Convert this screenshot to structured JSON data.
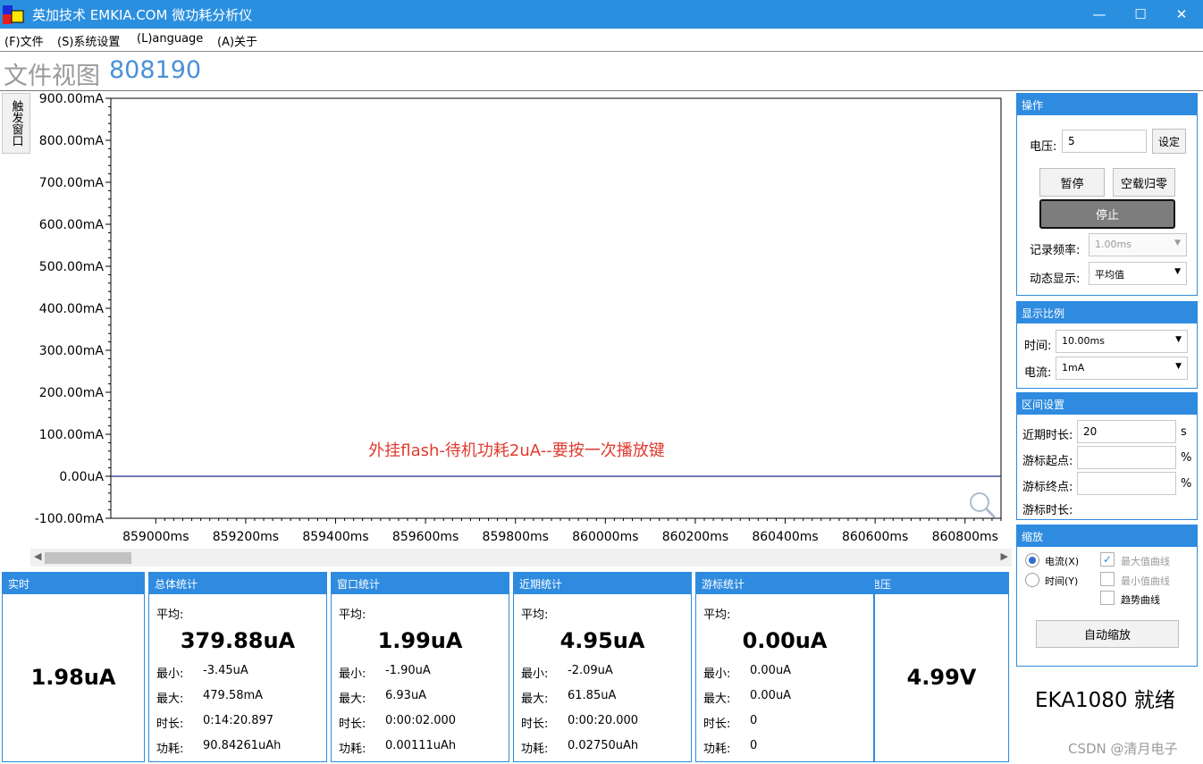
{
  "window": {
    "title": "英加技术 EMKIA.COM 微功耗分析仪",
    "minimize_glyph": "—",
    "maximize_glyph": "☐",
    "close_glyph": "✕"
  },
  "menu": [
    "(F)文件",
    "(S)系统设置",
    "(L)anguage",
    "(A)关于"
  ],
  "view": {
    "label": "文件视图",
    "number": "808190"
  },
  "trigger_tab": "触发窗口",
  "chart_data": {
    "type": "line",
    "y_ticks": [
      "900.00mA",
      "800.00mA",
      "700.00mA",
      "600.00mA",
      "500.00mA",
      "400.00mA",
      "300.00mA",
      "200.00mA",
      "100.00mA",
      "0.00uA",
      "-100.00mA"
    ],
    "y_values_mA": [
      900,
      800,
      700,
      600,
      500,
      400,
      300,
      200,
      100,
      0,
      -100
    ],
    "x_ticks": [
      "859000ms",
      "859200ms",
      "859400ms",
      "859600ms",
      "859800ms",
      "860000ms",
      "860200ms",
      "860400ms",
      "860600ms",
      "860800ms"
    ],
    "x_values_ms": [
      859000,
      859200,
      859400,
      859600,
      859800,
      860000,
      860200,
      860400,
      860600,
      860800
    ],
    "xlim": [
      858900,
      860880
    ],
    "ylim": [
      -100,
      900
    ],
    "series": [
      {
        "x": [
          858900,
          860880
        ],
        "y": [
          0.002,
          0.002
        ],
        "color": "#1f2a8a"
      }
    ],
    "annotation": "外挂flash-待机功耗2uA--要按一次播放键",
    "annotation_color": "#e03a2f",
    "grid": false
  },
  "stats": {
    "realtime": {
      "title": "实时",
      "value": "1.98uA"
    },
    "total": {
      "title": "总体统计",
      "avg_label": "平均:",
      "avg": "379.88uA",
      "min_label": "最小:",
      "min": "-3.45uA",
      "max_label": "最大:",
      "max": "479.58mA",
      "dur_label": "时长:",
      "dur": "0:14:20.897",
      "energy_label": "功耗:",
      "energy": "90.84261uAh"
    },
    "window": {
      "title": "窗口统计",
      "avg_label": "平均:",
      "avg": "1.99uA",
      "min_label": "最小:",
      "min": "-1.90uA",
      "max_label": "最大:",
      "max": "6.93uA",
      "dur_label": "时长:",
      "dur": "0:00:02.000",
      "energy_label": "功耗:",
      "energy": "0.00111uAh"
    },
    "recent": {
      "title": "近期统计",
      "avg_label": "平均:",
      "avg": "4.95uA",
      "min_label": "最小:",
      "min": "-2.09uA",
      "max_label": "最大:",
      "max": "61.85uA",
      "dur_label": "时长:",
      "dur": "0:00:20.000",
      "energy_label": "功耗:",
      "energy": "0.02750uAh"
    },
    "cursor": {
      "title": "游标统计",
      "avg_label": "平均:",
      "avg": "0.00uA",
      "min_label": "最小:",
      "min": "0.00uA",
      "max_label": "最大:",
      "max": "0.00uA",
      "dur_label": "时长:",
      "dur": "0",
      "energy_label": "功耗:",
      "energy": "0"
    },
    "voltage": {
      "title": "电压",
      "value": "4.99V"
    }
  },
  "operation": {
    "title": "操作",
    "voltage_label": "电压:",
    "voltage_value": "5",
    "set_button": "设定",
    "pause_button": "暂停",
    "zero_button": "空载归零",
    "stop_button": "停止",
    "rate_label": "记录频率:",
    "rate_value": "1.00ms",
    "dynamic_label": "动态显示:",
    "dynamic_value": "平均值"
  },
  "scale": {
    "title": "显示比例",
    "time_label": "时间:",
    "time_value": "10.00ms",
    "current_label": "电流:",
    "current_value": "1mA"
  },
  "interval": {
    "title": "区间设置",
    "recent_label": "近期时长:",
    "recent_value": "20",
    "recent_unit": "s",
    "start_label": "游标起点:",
    "start_unit": "%",
    "end_label": "游标终点:",
    "end_unit": "%",
    "dur_label": "游标时长:"
  },
  "zoom": {
    "title": "缩放",
    "radio_current": "电流(X)",
    "radio_time": "时间(Y)",
    "cb_max": "最大值曲线",
    "cb_min": "最小值曲线",
    "cb_trend": "趋势曲线",
    "auto_button": "自动缩放"
  },
  "status": {
    "text": "EKA1080  就绪"
  },
  "watermark": "CSDN @清月电子"
}
